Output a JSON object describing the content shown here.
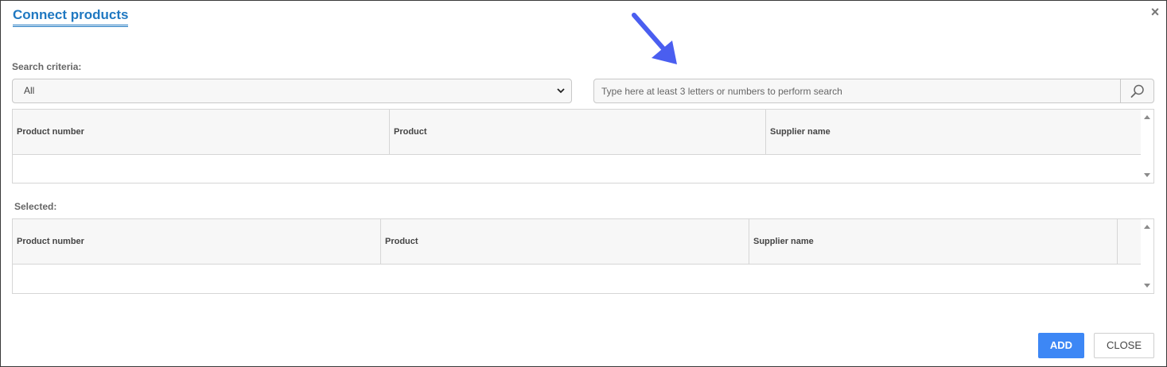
{
  "dialog": {
    "title": "Connect products",
    "close_icon": "close-icon"
  },
  "search": {
    "criteria_label": "Search criteria:",
    "criteria_selected": "All",
    "placeholder": "Type here at least 3 letters or numbers to perform search",
    "value": ""
  },
  "results_grid": {
    "columns": [
      "Product number",
      "Product",
      "Supplier name"
    ],
    "rows": []
  },
  "selected": {
    "label": "Selected:",
    "columns": [
      "Product number",
      "Product",
      "Supplier name"
    ],
    "rows": []
  },
  "footer": {
    "add_label": "ADD",
    "close_label": "CLOSE"
  },
  "colors": {
    "accent": "#1f78c1",
    "primary_button": "#3d87f5",
    "annotation_arrow": "#4a5ef0"
  }
}
